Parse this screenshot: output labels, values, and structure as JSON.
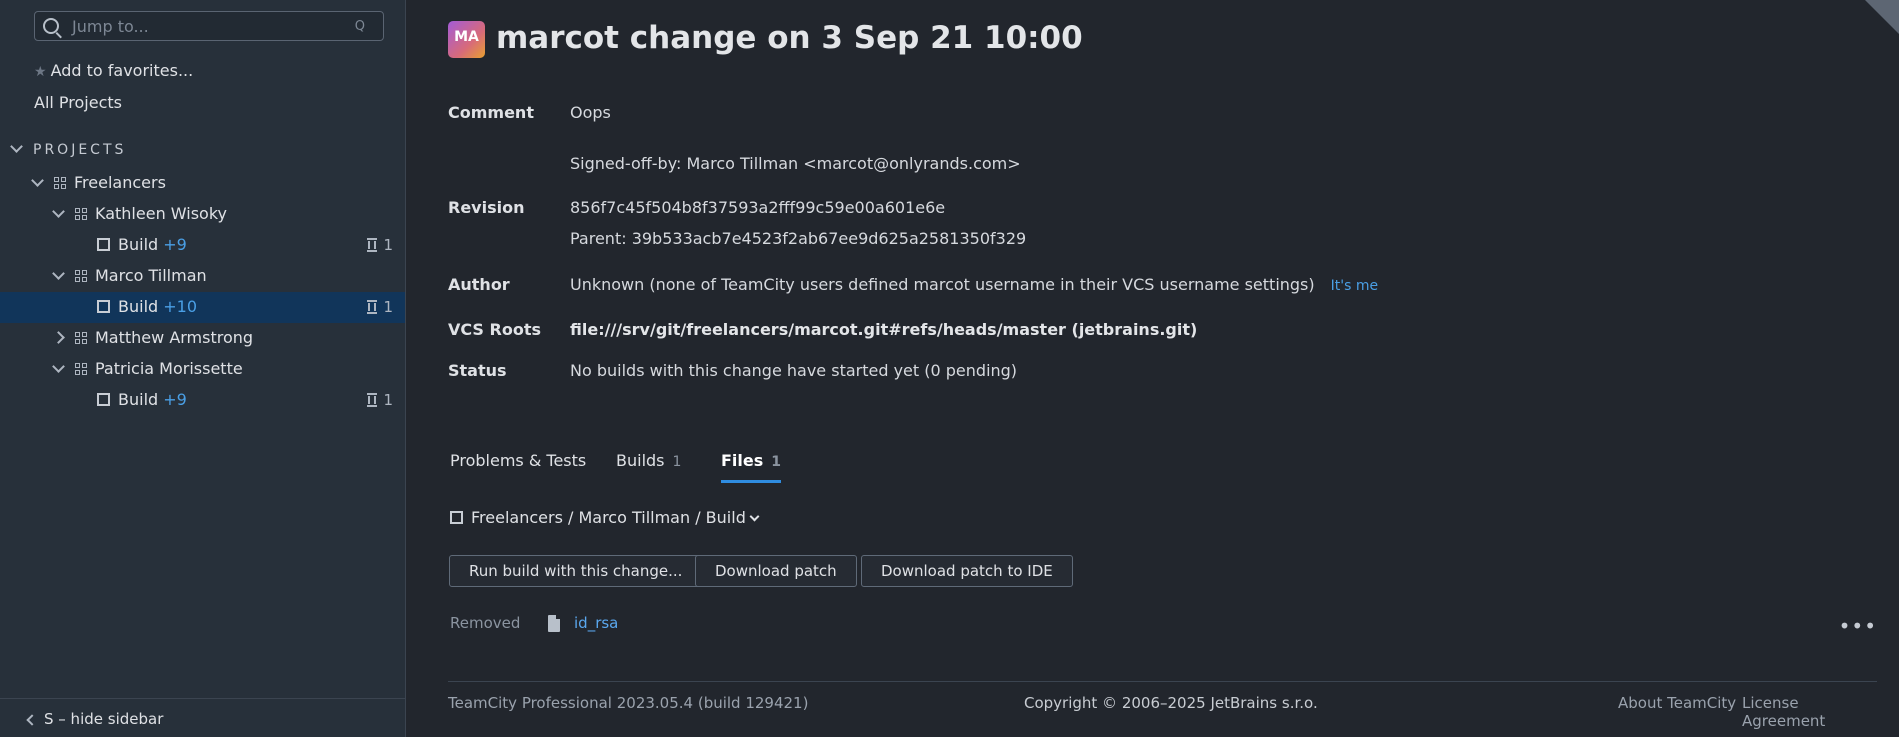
{
  "sidebar": {
    "search_placeholder": "Jump to...",
    "search_shortcut": "Q",
    "add_favorites": "Add to favorites...",
    "all_projects": "All Projects",
    "projects_header": "PROJECTS",
    "tree": {
      "freelancers": "Freelancers",
      "kathleen": "Kathleen Wisoky",
      "kathleen_build": "Build",
      "kathleen_plus": "+9",
      "kathleen_queue": "1",
      "marco": "Marco Tillman",
      "marco_build": "Build",
      "marco_plus": "+10",
      "marco_queue": "1",
      "matthew": "Matthew Armstrong",
      "patricia": "Patricia Morissette",
      "patricia_build": "Build",
      "patricia_plus": "+9",
      "patricia_queue": "1"
    },
    "hide_sidebar": "S – hide sidebar"
  },
  "change": {
    "avatar_initials": "MA",
    "title": "marcot change on 3 Sep 21 10:00",
    "comment_label": "Comment",
    "comment_line1": "Oops",
    "comment_line2": "Signed-off-by: Marco Tillman <marcot@onlyrands.com>",
    "revision_label": "Revision",
    "revision": "856f7c45f504b8f37593a2fff99c59e00a601e6e",
    "parent": "Parent: 39b533acb7e4523f2ab67ee9d625a2581350f329",
    "author_label": "Author",
    "author": "Unknown (none of TeamCity users defined marcot username in their VCS username settings)",
    "its_me": "It's me",
    "vcs_label": "VCS Roots",
    "vcs": "file:///srv/git/freelancers/marcot.git#refs/heads/master (jetbrains.git)",
    "status_label": "Status",
    "status": "No builds with this change have started yet (0 pending)"
  },
  "tabs": {
    "problems": "Problems & Tests",
    "builds": "Builds",
    "builds_count": "1",
    "files": "Files",
    "files_count": "1"
  },
  "files": {
    "breadcrumb": "Freelancers / Marco Tillman / Build",
    "run_build": "Run build with this change...",
    "download_patch": "Download patch",
    "download_patch_ide": "Download patch to IDE",
    "removed": "Removed",
    "filename": "id_rsa",
    "more": "•••"
  },
  "footer": {
    "version": "TeamCity Professional 2023.05.4 (build 129421)",
    "copyright": "Copyright © 2006–2025 JetBrains s.r.o.",
    "about": "About TeamCity",
    "license": "License Agreement"
  },
  "colors": {
    "accent": "#2f8ce0",
    "link": "#4a9fe5",
    "selected_row": "#11355a",
    "background": "#22262d",
    "sidebar": "#27303a"
  }
}
